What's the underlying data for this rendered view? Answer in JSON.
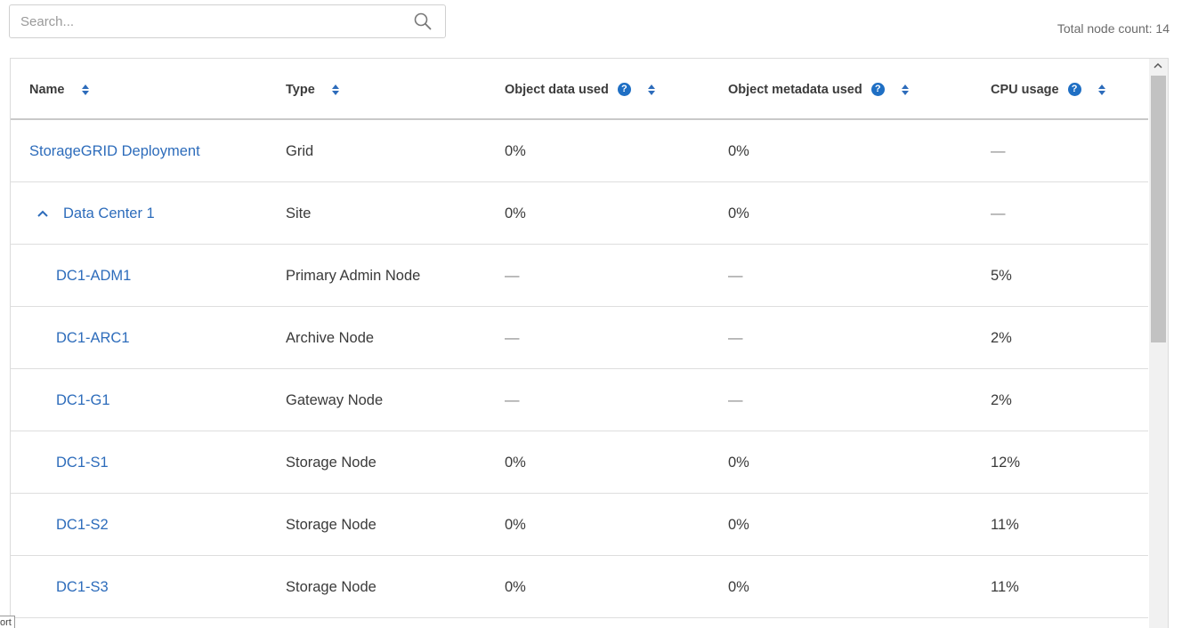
{
  "search": {
    "placeholder": "Search..."
  },
  "total_node_count": "Total node count: 14",
  "table": {
    "columns": [
      {
        "label": "Name",
        "help": false
      },
      {
        "label": "Type",
        "help": false
      },
      {
        "label": "Object data used",
        "help": true
      },
      {
        "label": "Object metadata used",
        "help": true
      },
      {
        "label": "CPU usage",
        "help": true
      }
    ],
    "rows": [
      {
        "name": "StorageGRID Deployment",
        "type": "Grid",
        "object_data_used": "0%",
        "object_metadata_used": "0%",
        "cpu_usage": "—"
      },
      {
        "name": "Data Center 1",
        "type": "Site",
        "object_data_used": "0%",
        "object_metadata_used": "0%",
        "cpu_usage": "—",
        "expanded": true
      },
      {
        "name": "DC1-ADM1",
        "type": "Primary Admin Node",
        "object_data_used": "—",
        "object_metadata_used": "—",
        "cpu_usage": "5%"
      },
      {
        "name": "DC1-ARC1",
        "type": "Archive Node",
        "object_data_used": "—",
        "object_metadata_used": "—",
        "cpu_usage": "2%"
      },
      {
        "name": "DC1-G1",
        "type": "Gateway Node",
        "object_data_used": "—",
        "object_metadata_used": "—",
        "cpu_usage": "2%"
      },
      {
        "name": "DC1-S1",
        "type": "Storage Node",
        "object_data_used": "0%",
        "object_metadata_used": "0%",
        "cpu_usage": "12%"
      },
      {
        "name": "DC1-S2",
        "type": "Storage Node",
        "object_data_used": "0%",
        "object_metadata_used": "0%",
        "cpu_usage": "11%"
      },
      {
        "name": "DC1-S3",
        "type": "Storage Node",
        "object_data_used": "0%",
        "object_metadata_used": "0%",
        "cpu_usage": "11%"
      }
    ]
  },
  "tooltip_fragment": "ort",
  "colors": {
    "link": "#2d6cbb",
    "help_icon": "#1f6fc4",
    "header_text": "#3b3b3b"
  },
  "icons": {
    "search": "search-icon",
    "sort": "sort-icon",
    "help": "help-icon",
    "expand": "chevron-up-icon"
  }
}
